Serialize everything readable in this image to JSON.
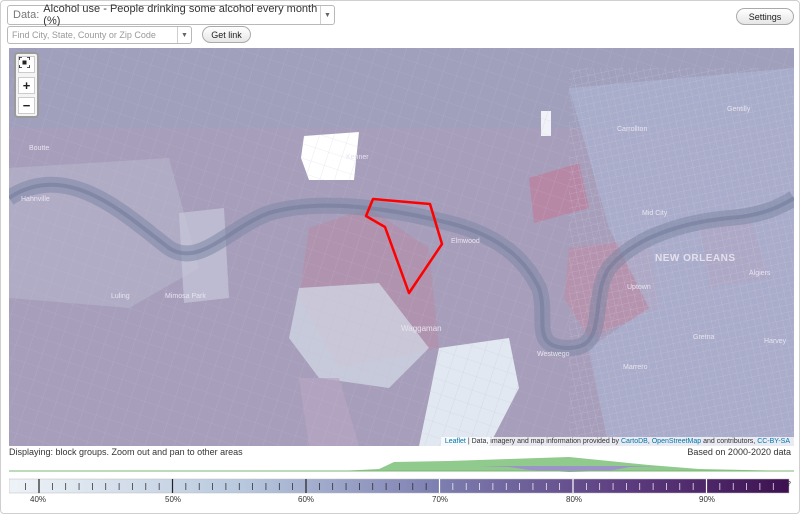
{
  "toolbar": {
    "data_prefix": "Data:",
    "data_value": "Alcohol use - People drinking some alcohol every month (%)",
    "search_placeholder": "Find City, State, County or Zip Code",
    "get_link_label": "Get link",
    "settings_label": "Settings",
    "caret_icon": "chevron-down-icon"
  },
  "map": {
    "zoom_in_label": "+",
    "zoom_out_label": "−",
    "fullscreen_icon": "fullscreen-icon",
    "labels": {
      "kenner": "Kenner",
      "hahnville": "Hahnville",
      "boutte": "Boutte",
      "luling": "Luling",
      "mimosa_park": "Mimosa Park",
      "elmwood": "Elmwood",
      "waggaman": "Waggaman",
      "westwego": "Westwego",
      "new_orleans": "NEW ORLEANS",
      "gentilly": "Gentilly",
      "mid_city": "Mid City",
      "uptown": "Uptown",
      "marrero": "Marrero",
      "gretna": "Gretna",
      "harvey": "Harvey",
      "algiers": "Algiers",
      "carrollton": "Carrollton"
    },
    "attribution": {
      "leaflet": "Leaflet",
      "text1": " | Data, imagery and map information provided by ",
      "cartodb": "CartoDB",
      "comma": ", ",
      "osm": "OpenStreetMap",
      "text2": " and contributors, ",
      "license": "CC-BY-SA"
    },
    "colors": {
      "low": "#e6eef5",
      "mid": "#8d9fc2",
      "high": "#b08aa6",
      "selection_outline": "#ff0000"
    }
  },
  "status": {
    "displaying": "Displaying: block groups. Zoom out and pan to other areas",
    "based_on": "Based on 2000-2020 data"
  },
  "legend": {
    "min": 37,
    "max": 97,
    "labels": [
      "40%",
      "50%",
      "60%",
      "70%",
      "80%",
      "90%"
    ],
    "help": "?"
  },
  "histogram": {
    "green_color": "#7fbf7b",
    "purple_color": "#9b8ec7"
  }
}
